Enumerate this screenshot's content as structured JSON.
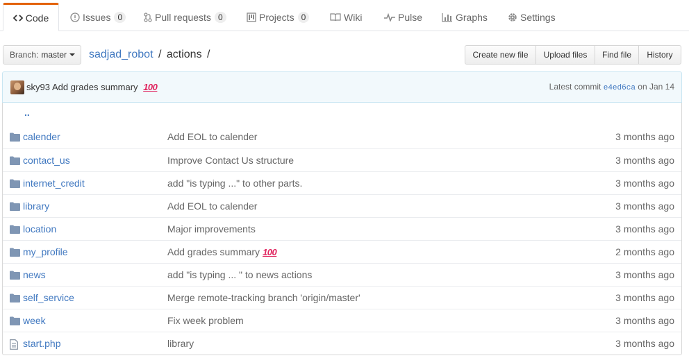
{
  "tabs": [
    {
      "label": "Code",
      "icon": "code-icon",
      "selected": true
    },
    {
      "label": "Issues",
      "icon": "issue-icon",
      "count": "0"
    },
    {
      "label": "Pull requests",
      "icon": "pull-request-icon",
      "count": "0"
    },
    {
      "label": "Projects",
      "icon": "project-icon",
      "count": "0"
    },
    {
      "label": "Wiki",
      "icon": "book-icon"
    },
    {
      "label": "Pulse",
      "icon": "pulse-icon"
    },
    {
      "label": "Graphs",
      "icon": "graph-icon"
    },
    {
      "label": "Settings",
      "icon": "gear-icon"
    }
  ],
  "branch": {
    "prefix": "Branch:",
    "name": "master"
  },
  "breadcrumb": {
    "repo": "sadjad_robot",
    "sep1": "/",
    "folder": "actions",
    "sep2": "/"
  },
  "file_buttons": [
    "Create new file",
    "Upload files",
    "Find file",
    "History"
  ],
  "latest_commit": {
    "author": "sky93",
    "message": "Add grades summary",
    "emoji": "💯",
    "label": "Latest commit",
    "sha": "e4ed6ca",
    "date": "on Jan 14"
  },
  "parent_dir": "..",
  "files": [
    {
      "type": "dir",
      "name": "calender",
      "message": "Add EOL to calender",
      "age": "3 months ago"
    },
    {
      "type": "dir",
      "name": "contact_us",
      "message": "Improve Contact Us structure",
      "age": "3 months ago"
    },
    {
      "type": "dir",
      "name": "internet_credit",
      "message": "add \"is typing ...\" to other parts.",
      "age": "3 months ago"
    },
    {
      "type": "dir",
      "name": "library",
      "message": "Add EOL to calender",
      "age": "3 months ago"
    },
    {
      "type": "dir",
      "name": "location",
      "message": "Major improvements",
      "age": "3 months ago"
    },
    {
      "type": "dir",
      "name": "my_profile",
      "message": "Add grades summary",
      "emoji": "💯",
      "age": "2 months ago"
    },
    {
      "type": "dir",
      "name": "news",
      "message": "add \"is typing ... \" to news actions",
      "age": "3 months ago"
    },
    {
      "type": "dir",
      "name": "self_service",
      "message": "Merge remote-tracking branch 'origin/master'",
      "age": "3 months ago"
    },
    {
      "type": "dir",
      "name": "week",
      "message": "Fix week problem",
      "age": "3 months ago"
    },
    {
      "type": "file",
      "name": "start.php",
      "message": "library",
      "age": "3 months ago"
    }
  ],
  "colors": {
    "link": "#4078c0",
    "tab_accent": "#e36209",
    "tease_bg": "#f2f9fc",
    "folder": "#7f96b4"
  }
}
